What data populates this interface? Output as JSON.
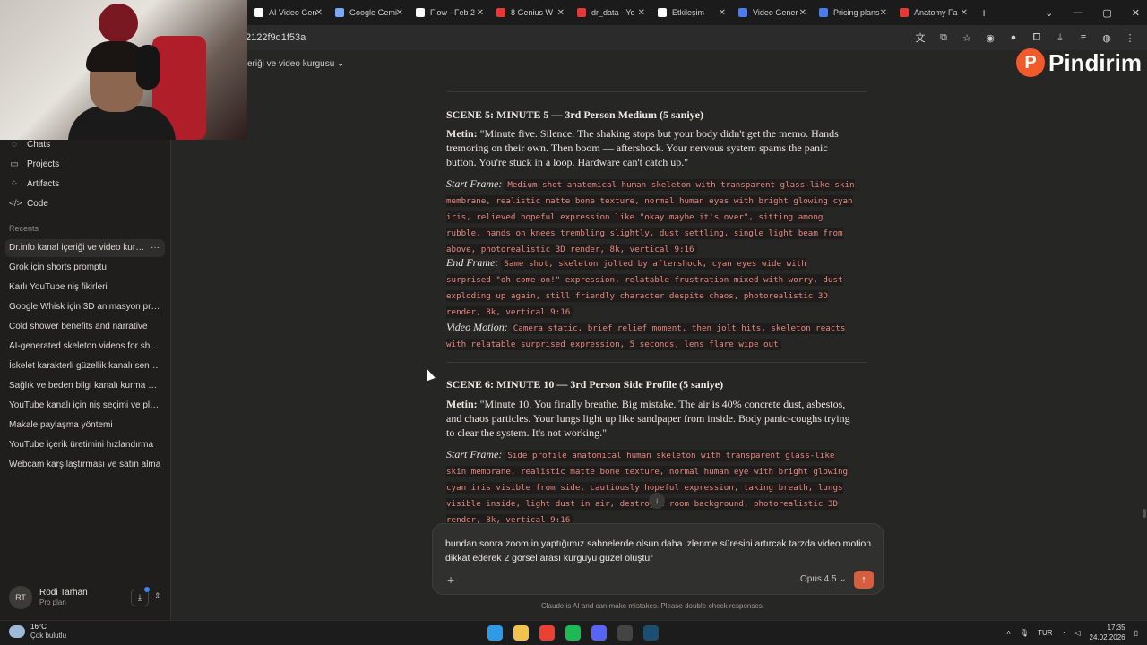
{
  "browser": {
    "tabs": [
      {
        "label": "",
        "color": "#4a4a4a"
      },
      {
        "label": "AI Video Gen",
        "color": "#ffffff"
      },
      {
        "label": "Google Gemi",
        "color": "#7aa7f7"
      },
      {
        "label": "Flow - Feb 2",
        "color": "#ffffff"
      },
      {
        "label": "8 Genius W",
        "color": "#e53935"
      },
      {
        "label": "dr_data - Yo",
        "color": "#e53935"
      },
      {
        "label": "Etkileşim",
        "color": "#ffffff"
      },
      {
        "label": "Video Gener",
        "color": "#4b7bec"
      },
      {
        "label": "Pricing plans",
        "color": "#4b7bec"
      },
      {
        "label": "Anatomy Fa",
        "color": "#e53935"
      }
    ],
    "new_tab": "+",
    "url": "2122f9d1f53a",
    "window_controls": [
      "⌄",
      "—",
      "▢",
      "✕"
    ]
  },
  "watermark": {
    "logo": "P",
    "text": "Pindirim"
  },
  "conversation_title": "eriği ve video kurgusu  ⌄",
  "sidebar": {
    "nav": [
      {
        "icon": "chats-icon",
        "glyph": "◌",
        "label": "Chats"
      },
      {
        "icon": "projects-icon",
        "glyph": "▭",
        "label": "Projects"
      },
      {
        "icon": "artifacts-icon",
        "glyph": "⁘",
        "label": "Artifacts"
      },
      {
        "icon": "code-icon",
        "glyph": "</>",
        "label": "Code"
      }
    ],
    "recents_label": "Recents",
    "recents": [
      "Dr.info kanal içeriği ve video kurgusu",
      "Grok için shorts promptu",
      "Karlı YouTube niş fikirleri",
      "Google Whisk için 3D animasyon promptu",
      "Cold shower benefits and narrative",
      "AI-generated skeleton videos for shorts",
      "İskelet karakterli güzellik kanalı senaryo",
      "Sağlık ve beden bilgi kanalı kurma planı",
      "YouTube kanalı için niş seçimi ve planlama",
      "Makale paylaşma yöntemi",
      "YouTube içerik üretimini hızlandırma",
      "Webcam karşılaştırması ve satın alma"
    ],
    "more": "···",
    "user": {
      "initials": "RT",
      "name": "Rodi Tarhan",
      "plan": "Pro plan"
    }
  },
  "scenes": [
    {
      "title": "SCENE 5: MINUTE 5 — 3rd Person Medium (5 saniye)",
      "metin_label": "Metin:",
      "metin": " \"Minute five. Silence. The shaking stops but your body didn't get the memo. Hands tremoring on their own. Then boom — aftershock. Your nervous system spams the panic button. You're stuck in a loop. Hardware can't catch up.\"",
      "start_label": "Start Frame:",
      "start": "Medium shot anatomical human skeleton with transparent glass-like skin membrane, realistic matte bone texture, normal human eyes with bright glowing cyan iris, relieved hopeful expression like \"okay maybe it's over\", sitting among rubble, hands on knees trembling slightly, dust settling, single light beam from above, photorealistic 3D render, 8k, vertical 9:16",
      "end_label": "End Frame:",
      "end": "Same shot, skeleton jolted by aftershock, cyan eyes wide with surprised \"oh come on!\" expression, relatable frustration mixed with worry, dust exploding up again, still friendly character despite chaos, photorealistic 3D render, 8k, vertical 9:16",
      "motion_label": "Video Motion:",
      "motion": "Camera static, brief relief moment, then jolt hits, skeleton reacts with relatable surprised expression, 5 seconds, lens flare wipe out"
    },
    {
      "title": "SCENE 6: MINUTE 10 — 3rd Person Side Profile (5 saniye)",
      "metin_label": "Metin:",
      "metin": " \"Minute 10. You finally breathe. Big mistake. The air is 40% concrete dust, asbestos, and chaos particles. Your lungs light up like sandpaper from inside. Body panic-coughs trying to clear the system. It's not working.\"",
      "start_label": "Start Frame:",
      "start": "Side profile anatomical human skeleton with transparent glass-like skin membrane, realistic matte bone texture, normal human eye with bright glowing cyan iris visible from side, cautiously hopeful expression, taking breath, lungs visible inside, light dust in air, destroyed room background, photorealistic 3D render, 8k, vertical 9:16"
    }
  ],
  "composer": {
    "text": "bundan sonra zoom in yaptığımız sahnelerde olsun daha izlenme süresini artırcak tarzda video motion dikkat ederek 2 görsel arası kurguyu güzel oluştur",
    "plus": "+",
    "model": "Opus 4.5  ⌄",
    "send": "↑",
    "scroll_down": "↓"
  },
  "disclaimer": "Claude is AI and can make mistakes. Please double-check responses.",
  "taskbar": {
    "temp": "16°C",
    "condition": "Çok bulutlu",
    "apps": [
      {
        "name": "windows-start-icon",
        "color": "#2f9be6"
      },
      {
        "name": "file-explorer-icon",
        "color": "#f2c14e"
      },
      {
        "name": "chrome-icon",
        "color": "#e94235"
      },
      {
        "name": "spotify-icon",
        "color": "#1db954"
      },
      {
        "name": "discord-icon",
        "color": "#5865f2"
      },
      {
        "name": "obs-icon",
        "color": "#444444"
      },
      {
        "name": "steam-icon",
        "color": "#1b4f72"
      }
    ],
    "lang": "TUR",
    "time": "17:35",
    "date": "24.02.2026"
  }
}
